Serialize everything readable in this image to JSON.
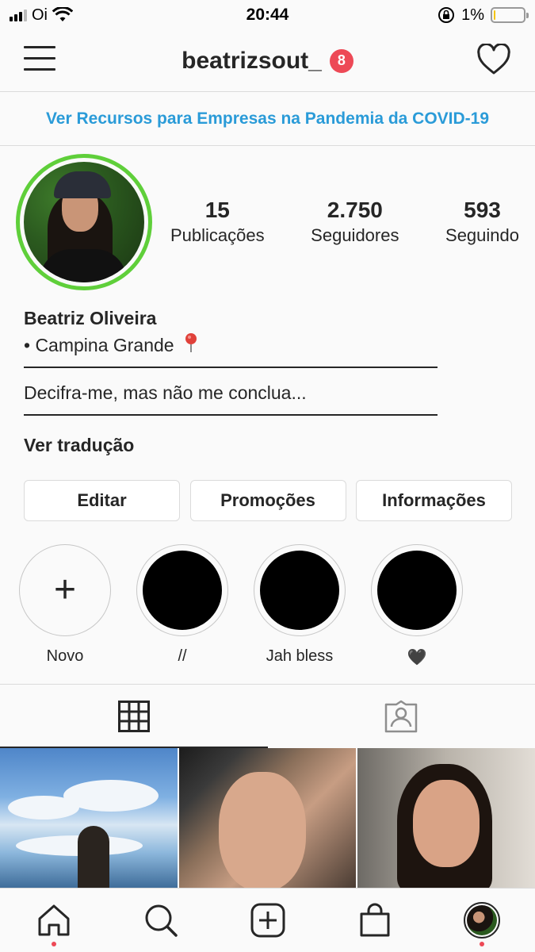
{
  "status_bar": {
    "carrier": "Oi",
    "time": "20:44",
    "battery": "1%",
    "battery_level": 0.05
  },
  "header": {
    "username": "beatrizsout_",
    "notification_count": "8"
  },
  "banner": {
    "text": "Ver Recursos para Empresas na Pandemia da COVID-19"
  },
  "profile": {
    "stats": [
      {
        "value": "15",
        "label": "Publicações"
      },
      {
        "value": "2.750",
        "label": "Seguidores"
      },
      {
        "value": "593",
        "label": "Seguindo"
      }
    ],
    "name": "Beatriz Oliveira",
    "location_line": "• Campina Grande",
    "bio": "Decifra-me, mas não me conclua...",
    "translate": "Ver tradução"
  },
  "buttons": {
    "edit": "Editar",
    "promotions": "Promoções",
    "info": "Informações"
  },
  "highlights": [
    {
      "label": "Novo",
      "type": "new"
    },
    {
      "label": "//",
      "type": "story"
    },
    {
      "label": "Jah bless",
      "type": "story"
    },
    {
      "label": "🖤",
      "type": "story"
    }
  ],
  "colors": {
    "accent": "#2a9bd8",
    "badge": "#ed4956",
    "story_ring": "#5fcf3a"
  },
  "icons": {
    "header_left": "hamburger-menu-icon",
    "header_right": "heart-icon",
    "tab_grid": "grid-icon",
    "tab_tagged": "tagged-person-icon",
    "bottom_nav": [
      "home-icon",
      "search-icon",
      "add-post-icon",
      "shopping-bag-icon",
      "profile-avatar"
    ]
  }
}
